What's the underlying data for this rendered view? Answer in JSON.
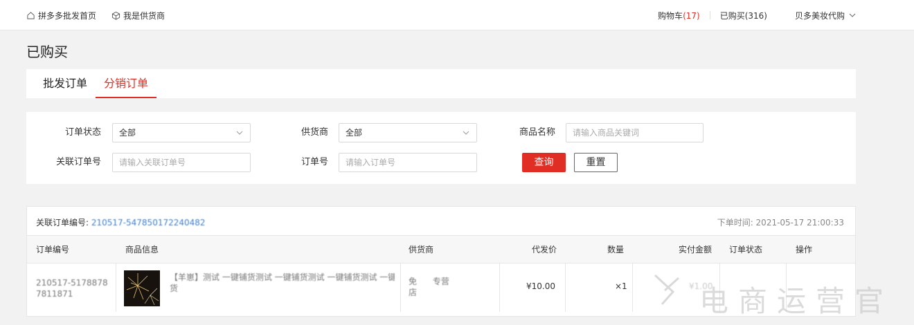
{
  "topbar": {
    "home_label": "拼多多批发首页",
    "supplier_label": "我是供货商",
    "cart_label": "购物车",
    "cart_count": "(17)",
    "bought_label": "已购买(316)",
    "account_label": "贝多美妆代购"
  },
  "page_title": "已购买",
  "tabs": [
    {
      "label": "批发订单",
      "active": false
    },
    {
      "label": "分销订单",
      "active": true
    }
  ],
  "filter": {
    "order_status_label": "订单状态",
    "order_status_value": "全部",
    "supplier_label": "供货商",
    "supplier_value": "全部",
    "product_name_label": "商品名称",
    "product_name_placeholder": "请输入商品关键词",
    "related_order_label": "关联订单号",
    "related_order_placeholder": "请输入关联订单号",
    "order_no_label": "订单号",
    "order_no_placeholder": "请输入订单号",
    "query_button": "查询",
    "reset_button": "重置"
  },
  "order": {
    "related_label": "关联订单编号:",
    "related_number": "210517-547850172240482",
    "time_text": "下单时间: 2021-05-17 21:00:33",
    "columns": [
      "订单编号",
      "商品信息",
      "供货商",
      "代发价",
      "数量",
      "实付金额",
      "订单状态",
      "操作"
    ],
    "row": {
      "order_no_line1": "210517-5178878",
      "order_no_line2": "7811871",
      "product_title_line1": "【羊崽】测试 一键铺货测试 一键铺货测试 一键铺货测试 一键铺",
      "product_title_line2": "货",
      "supplier_line1": "免      专营",
      "supplier_line2": "店",
      "price": "¥10.00",
      "quantity": "×1",
      "paid": "¥1.00"
    }
  },
  "watermark": {
    "text": "电商运营官"
  },
  "colors": {
    "accent": "#e02e24",
    "link": "#3b7fd0"
  }
}
